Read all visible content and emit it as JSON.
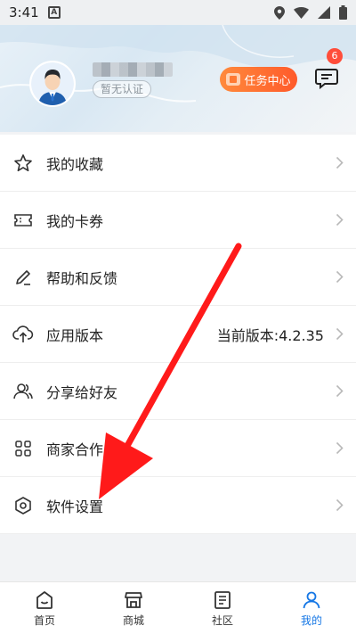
{
  "status_bar": {
    "time": "3:41",
    "app_badge": "A",
    "battery_icon": "battery-icon",
    "wifi_icon": "wifi-icon",
    "signal_icon": "signal-icon",
    "location_icon": "location-icon"
  },
  "profile": {
    "auth_status": "暂无认证",
    "task_center": "任务中心",
    "message_count": "6"
  },
  "menu": {
    "items": [
      {
        "label": "我的收藏",
        "icon": "star-icon"
      },
      {
        "label": "我的卡券",
        "icon": "ticket-icon"
      },
      {
        "label": "帮助和反馈",
        "icon": "pencil-icon"
      },
      {
        "label": "应用版本",
        "icon": "cloud-upload-icon",
        "value": "当前版本:4.2.35"
      },
      {
        "label": "分享给好友",
        "icon": "users-icon"
      },
      {
        "label": "商家合作",
        "icon": "grid-icon"
      },
      {
        "label": "软件设置",
        "icon": "settings-icon"
      }
    ]
  },
  "bottom_nav": {
    "items": [
      {
        "label": "首页",
        "icon": "home-icon"
      },
      {
        "label": "商城",
        "icon": "store-icon"
      },
      {
        "label": "社区",
        "icon": "community-icon"
      },
      {
        "label": "我的",
        "icon": "profile-icon",
        "active": true
      }
    ]
  },
  "colors": {
    "accent": "#1677e5",
    "task_button": "#ff6a2e",
    "badge": "#ff4d3a",
    "arrow": "#ff1a1a"
  }
}
